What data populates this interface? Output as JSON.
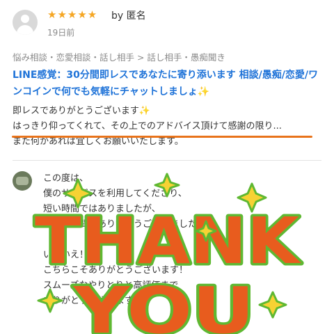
{
  "review": {
    "rating": 5,
    "stars": "★★★★★",
    "by_label": "by 匿名",
    "time": "19日前"
  },
  "breadcrumb": "悩み相談・恋愛相談・話し相手 > 話し相手・愚痴聞き",
  "service_title": "LINE感覚：30分間即レスであなたに寄り添います 相談/愚痴/恋愛/ワンコインで何でも気軽にチャットしましょ✨",
  "message": {
    "line1": "即レスでありがとうございます✨",
    "line2": "はっきり仰ってくれて、その上でのアドバイス頂けて感謝の限り...",
    "line3": "また何かあれば宜しくお願いいたします。"
  },
  "reply": {
    "line1": "この度は、",
    "line2": "僕のサービスを利用してくださり、",
    "line3": "短い時間ではありましたが、",
    "line4": "素敵な時間をありがとうございました✨",
    "line5": "",
    "line6": "いえいえ！",
    "line7": "こちらこそありがとうございます！",
    "line8": "スムーズなやりとりと高評価まで",
    "line9": "ありがとうございます😊"
  },
  "sticker": {
    "line1": "THANK",
    "line2": "YOU",
    "fill_color": "#e85c1e",
    "outline_color": "#5fb832",
    "sparkle_color": "#f7d234"
  },
  "colors": {
    "star": "#f5a623",
    "link_title": "#1f73d8",
    "underline": "#e8731a"
  }
}
